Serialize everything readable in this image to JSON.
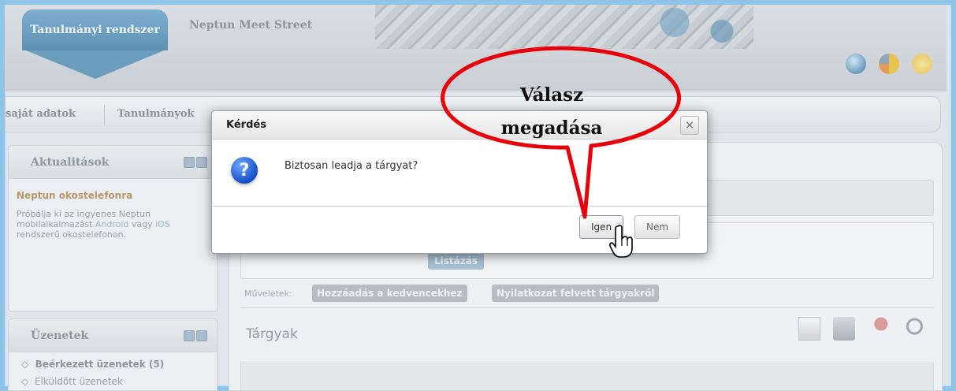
{
  "header": {
    "active_tab": "Tanulmányi rendszer",
    "inactive_tab": "Neptun Meet Street"
  },
  "menu": {
    "item1": "saját adatok",
    "item2": "Tanulmányok"
  },
  "sidebar": {
    "news": {
      "title": "Aktualitások",
      "item_title": "Neptun okostelefonra",
      "text_part1": "Próbálja ki az ingyenes Neptun mobilalkalmazást ",
      "link1": "Android",
      "text_part2": " vagy ",
      "link2": "iOS",
      "text_part3": " rendszerű okostelefonon."
    },
    "messages": {
      "title": "Üzenetek",
      "items": [
        "Beérkezett üzenetek (5)",
        "Elküldött üzenetek"
      ]
    }
  },
  "main": {
    "list_button": "Listázás",
    "ops_label": "Műveletek:",
    "op1": "Hozzáadás a kedvencekhez",
    "op2": "Nyilatkozat felvett tárgyakról",
    "section_title": "Tárgyak"
  },
  "dialog": {
    "title": "Kérdés",
    "close_symbol": "×",
    "icon_symbol": "?",
    "message": "Biztosan leadja a tárgyat?",
    "yes_label": "Igen",
    "no_label": "Nem"
  },
  "callout": {
    "line1": "Válasz",
    "line2": "megadása",
    "color": "#e8000a"
  }
}
